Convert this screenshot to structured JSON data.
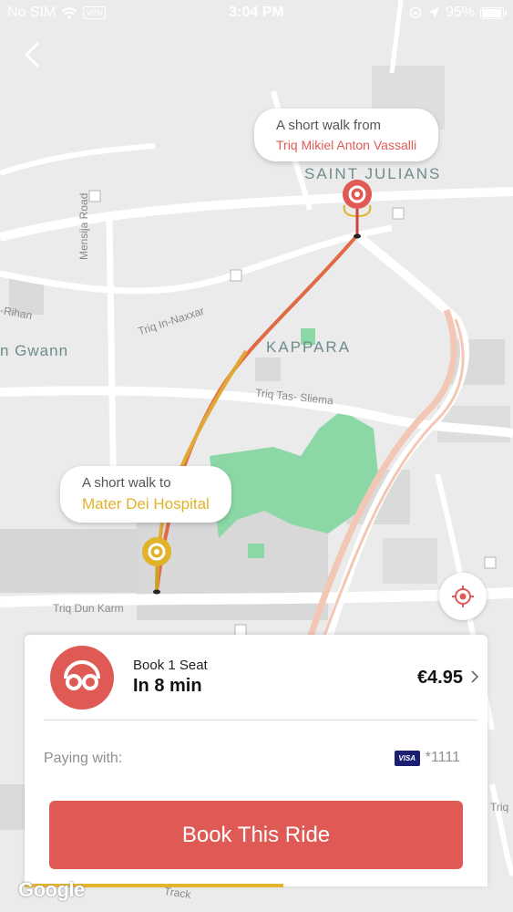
{
  "status_bar": {
    "carrier": "No SIM",
    "vpn": "VPN",
    "time": "3:04 PM",
    "battery": "95%",
    "battery_level": 0.95
  },
  "map": {
    "labels": {
      "saint_julians": "SAINT JULIANS",
      "kappara": "KAPPARA",
      "gwann": "n Gwann",
      "mensija_road": "Mensija Road",
      "triq_in_naxxar": "Triq In-Naxxar",
      "rihan": "-Rihan",
      "triq_tas_sliema": "Triq Tas- Sliema",
      "triq_dun_karm": "Triq Dun Karm",
      "track": "Track",
      "triq": "Triq"
    },
    "pickup_callout": {
      "line1": "A short walk from",
      "line2": "Triq Mikiel Anton Vassalli"
    },
    "dropoff_callout": {
      "line1": "A short walk to",
      "line2": "Mater Dei Hospital"
    },
    "attribution": "Google"
  },
  "ride": {
    "title": "Book 1 Seat",
    "eta": "In 8 min",
    "price": "€4.95"
  },
  "payment": {
    "label": "Paying with:",
    "card_brand": "VISA",
    "card_number": "*1111"
  },
  "actions": {
    "book_label": "Book This Ride"
  },
  "progress": 0.56,
  "colors": {
    "brand_red": "#e05a55",
    "accent_yellow": "#e0b32a",
    "park_green": "#8bd8a6"
  }
}
